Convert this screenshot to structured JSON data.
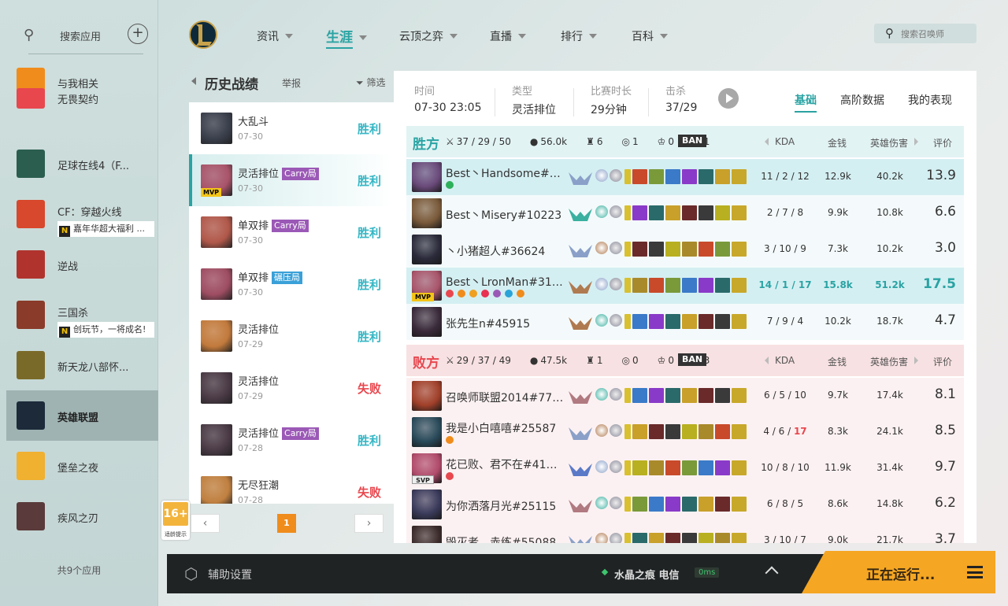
{
  "sidebar": {
    "search_label": "搜索应用",
    "apps": [
      {
        "name": "与我相关",
        "icon": "bell-hex-icon",
        "color": "#f08c1c"
      },
      {
        "name": "无畏契约",
        "icon": "valorant-icon",
        "color": "#e8474e"
      },
      {
        "name": "足球在线4（F...",
        "icon": "fifa-icon",
        "color": "#2b5e4f"
      },
      {
        "name": "CF：穿越火线",
        "sub": "嘉年华超大福利 ...",
        "icon": "crossfire-icon",
        "color": "#d8482c"
      },
      {
        "name": "逆战",
        "icon": "nizhan-icon",
        "color": "#b0342d"
      },
      {
        "name": "三国杀",
        "sub": "创玩节，一将成名!",
        "icon": "sanguosha-icon",
        "color": "#8a3b2a"
      },
      {
        "name": "新天龙八部怀...",
        "icon": "tianlong-icon",
        "color": "#7a6a2a"
      },
      {
        "name": "英雄联盟",
        "icon": "lol-icon",
        "color": "#1c2a3a",
        "active": true
      },
      {
        "name": "堡垒之夜",
        "icon": "fortnite-icon",
        "color": "#f0b030"
      },
      {
        "name": "疾风之刃",
        "icon": "jifeng-icon",
        "color": "#5a3a3a"
      }
    ],
    "count": "共9个应用"
  },
  "nav": {
    "items": [
      "资讯",
      "生涯",
      "云顶之弈",
      "直播",
      "排行",
      "百科"
    ],
    "active": "生涯",
    "search_placeholder": "搜索召唤师"
  },
  "history": {
    "title": "历史战绩",
    "report": "举报",
    "filter": "筛选",
    "rows": [
      {
        "mode": "大乱斗",
        "date": "07-30",
        "result": "胜利",
        "win": true,
        "color": "#3a3f4c"
      },
      {
        "mode": "灵活排位",
        "tag": "Carry局",
        "tag_color": "#9b59b6",
        "date": "07-30",
        "result": "胜利",
        "win": true,
        "mvp": "MVP",
        "color": "#a9546a",
        "selected": true
      },
      {
        "mode": "单双排",
        "tag": "Carry局",
        "tag_color": "#9b59b6",
        "date": "07-30",
        "result": "胜利",
        "win": true,
        "color": "#b0584a"
      },
      {
        "mode": "单双排",
        "tag": "碾压局",
        "tag_color": "#3aa0d8",
        "date": "07-30",
        "result": "胜利",
        "win": true,
        "color": "#9e4d62"
      },
      {
        "mode": "灵活排位",
        "date": "07-29",
        "result": "胜利",
        "win": true,
        "color": "#c27a3c"
      },
      {
        "mode": "灵活排位",
        "date": "07-29",
        "result": "失败",
        "win": false,
        "color": "#4a3a45"
      },
      {
        "mode": "灵活排位",
        "tag": "Carry局",
        "tag_color": "#9b59b6",
        "date": "07-28",
        "result": "胜利",
        "win": true,
        "color": "#4a3a45"
      },
      {
        "mode": "无尽狂潮",
        "date": "07-28",
        "result": "失败",
        "win": false,
        "color": "#c08040"
      }
    ],
    "page": "1",
    "age_rating": "16+",
    "age_tip": "适龄提示"
  },
  "detail": {
    "info": [
      {
        "label": "时间",
        "value": "07-30 23:05"
      },
      {
        "label": "类型",
        "value": "灵活排位"
      },
      {
        "label": "比赛时长",
        "value": "29分钟"
      },
      {
        "label": "击杀",
        "value": "37/29"
      }
    ],
    "tabs": [
      "基础",
      "高阶数据",
      "我的表现"
    ],
    "active_tab": "基础",
    "col_headers": [
      "KDA",
      "金钱",
      "英雄伤害",
      "评价"
    ],
    "ban_label": "BAN",
    "teams": [
      {
        "name": "胜方",
        "color": "#2aa3a3",
        "bg": "#e2f3f4",
        "row_bg": "#f4fafb",
        "kda": "37 / 29 / 50",
        "gold": "56.0k",
        "towers": "6",
        "dragons": "1",
        "barons": "0",
        "heralds": "1",
        "players": [
          {
            "name": "Best丶Handsome#63...",
            "kda": "11 / 2 / 12",
            "gold": "12.9k",
            "dmg": "40.2k",
            "score": "13.9",
            "color": "#6a4a7a",
            "rank": "#8aa0c8",
            "row": "#d4eff2",
            "badges": [
              "#2eb05a"
            ]
          },
          {
            "name": "Best丶Misery#10223",
            "kda": "2 / 7 / 8",
            "gold": "9.9k",
            "dmg": "10.8k",
            "score": "6.6",
            "color": "#7a5a3a",
            "rank": "#3ab0a0"
          },
          {
            "name": "丶小猪超人#36624",
            "kda": "3 / 10 / 9",
            "gold": "7.3k",
            "dmg": "10.2k",
            "score": "3.0",
            "color": "#2a2a3a",
            "rank": "#8aa0c8"
          },
          {
            "name": "Best丶LronMan#314...",
            "kda": "14 / 1 / 17",
            "gold": "15.8k",
            "dmg": "51.2k",
            "score": "17.5",
            "color": "#a9546a",
            "rank": "#b07a50",
            "row": "#d4eff2",
            "me": true,
            "mvp": "MVP",
            "badges": [
              "#e8474e",
              "#f08c1c",
              "#f0a020",
              "#e83050",
              "#9b59b6",
              "#2aa3d8",
              "#f08c1c"
            ]
          },
          {
            "name": "张先生n#45915",
            "kda": "7 / 9 / 4",
            "gold": "10.2k",
            "dmg": "18.7k",
            "score": "4.7",
            "color": "#3a2a3a",
            "rank": "#b07a50"
          }
        ]
      },
      {
        "name": "败方",
        "color": "#e8474e",
        "bg": "#f8e1e2",
        "row_bg": "#fcf1f2",
        "kda": "29 / 37 / 49",
        "gold": "47.5k",
        "towers": "1",
        "dragons": "0",
        "barons": "0",
        "heralds": "3",
        "players": [
          {
            "name": "召唤师联盟2014#771...",
            "kda": "6 / 5 / 10",
            "gold": "9.7k",
            "dmg": "17.4k",
            "score": "8.1",
            "color": "#a0402a",
            "rank": "#b07a80"
          },
          {
            "name": "我是小白嘻嘻#25587",
            "kda": "4 / 6 / ",
            "kda_red": "17",
            "gold": "8.3k",
            "dmg": "24.1k",
            "score": "8.5",
            "color": "#2a4a5a",
            "rank": "#8aa0c8",
            "badges": [
              "#f08c1c"
            ]
          },
          {
            "name": "花已败、君不在#41528",
            "kda": "10 / 8 / 10",
            "gold": "11.9k",
            "dmg": "31.4k",
            "score": "9.7",
            "color": "#b04a6a",
            "rank": "#5a7ac8",
            "mvp": "SVP",
            "badges": [
              "#e8474e"
            ]
          },
          {
            "name": "为你洒落月光#25115",
            "kda": "6 / 8 / 5",
            "gold": "8.6k",
            "dmg": "14.8k",
            "score": "6.2",
            "color": "#3a3a5a",
            "rank": "#b07a80"
          },
          {
            "name": "毁灭者、赤练#55088",
            "kda": "3 / 10 / 7",
            "gold": "9.0k",
            "dmg": "21.7k",
            "score": "3.7",
            "color": "#3a2a2a",
            "rank": "#8aa0c8"
          }
        ]
      }
    ]
  },
  "bottom": {
    "assist": "辅助设置",
    "server": "水晶之痕 电信",
    "ping": "0ms",
    "running": "正在运行..."
  },
  "colors": {
    "accent": "#2aa3a3",
    "win": "#35b6c4",
    "lose": "#e8474e",
    "orange": "#f5a623"
  }
}
